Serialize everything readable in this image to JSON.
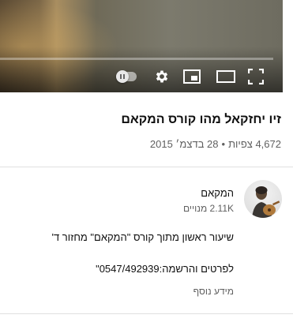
{
  "video": {
    "progress_fraction": 0.0,
    "controls": {
      "autoplay": "autoplay-toggle",
      "settings": "gear-icon",
      "miniplayer": "miniplayer-icon",
      "theater": "theater-mode-icon",
      "fullscreen": "fullscreen-icon"
    }
  },
  "title": "זיו יחזקאל מהו קורס המקאם",
  "meta": {
    "views": "4,672 צפיות",
    "separator": "•",
    "date": "28 בדצמ׳ 2015"
  },
  "channel": {
    "name": "המקאם",
    "subscribers": "2.11K מנויים"
  },
  "description": {
    "line1": "שיעור ראשון מתוך קורס \"המקאם\" מחזור ד'",
    "line2": "לפרטים והרשמה:0547/492939\""
  },
  "more_label": "מידע נוסף",
  "colors": {
    "progress": "#ff0000",
    "secondary_text": "#606060",
    "primary_text": "#0f0f0f"
  }
}
